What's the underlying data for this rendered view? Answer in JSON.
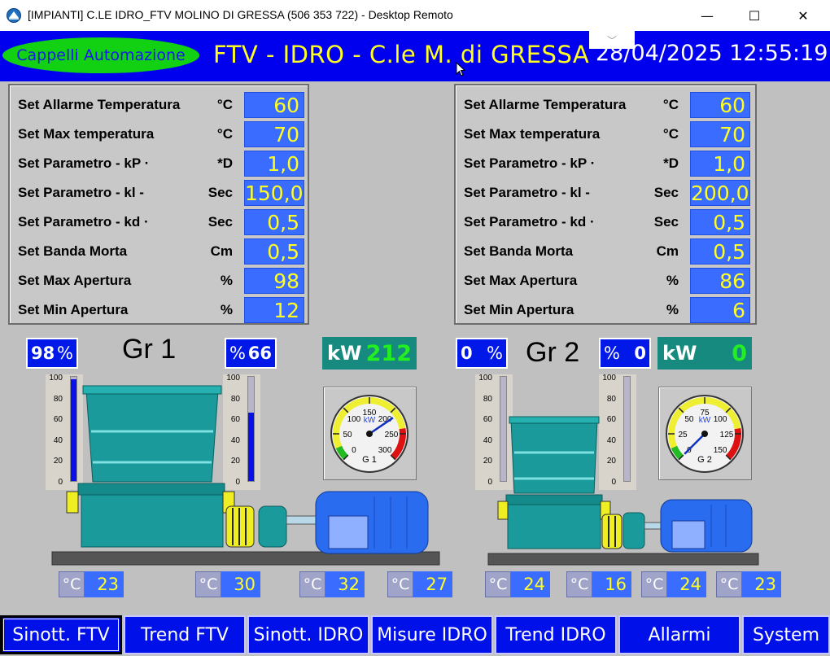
{
  "window": {
    "title": "[IMPIANTI] C.LE IDRO_FTV MOLINO DI GRESSA (506 353 722) - Desktop Remoto",
    "minimize": "—",
    "maximize": "☐",
    "close": "✕"
  },
  "header": {
    "brand": "Cappelli Automazione",
    "title": "FTV - IDRO - C.le M. di GRESSA",
    "datetime": "28/04/2025 12:55:19",
    "rd_chevron": "﹀"
  },
  "panels": [
    {
      "rows": [
        {
          "label": "Set Allarme Temperatura",
          "unit": "°C",
          "value": "60"
        },
        {
          "label": "Set Max temperatura",
          "unit": "°C",
          "value": "70"
        },
        {
          "label": "Set Parametro - kP ·",
          "unit": "*D",
          "value": "1,0"
        },
        {
          "label": "Set Parametro - kl -",
          "unit": "Sec",
          "value": "150,0"
        },
        {
          "label": "Set Parametro - kd ·",
          "unit": "Sec",
          "value": "0,5"
        },
        {
          "label": "Set Banda Morta",
          "unit": "Cm",
          "value": "0,5"
        },
        {
          "label": "Set Max Apertura",
          "unit": "%",
          "value": "98"
        },
        {
          "label": "Set Min Apertura",
          "unit": "%",
          "value": "12"
        }
      ]
    },
    {
      "rows": [
        {
          "label": "Set Allarme Temperatura",
          "unit": "°C",
          "value": "60"
        },
        {
          "label": "Set Max temperatura",
          "unit": "°C",
          "value": "70"
        },
        {
          "label": "Set Parametro - kP ·",
          "unit": "*D",
          "value": "1,0"
        },
        {
          "label": "Set Parametro - kl -",
          "unit": "Sec",
          "value": "200,0"
        },
        {
          "label": "Set Parametro - kd ·",
          "unit": "Sec",
          "value": "0,5"
        },
        {
          "label": "Set Banda Morta",
          "unit": "Cm",
          "value": "0,5"
        },
        {
          "label": "Set Max Apertura",
          "unit": "%",
          "value": "86"
        },
        {
          "label": "Set Min Apertura",
          "unit": "%",
          "value": "6"
        }
      ]
    }
  ],
  "groups": [
    {
      "name": "Gr 1",
      "opening_left": "98",
      "opening_right": "66",
      "pct": "%",
      "kw_label": "kW",
      "kw_value": "212",
      "scale_ticks": [
        "100",
        "80",
        "60",
        "40",
        "20",
        "0"
      ],
      "left_scale_level": 0.98,
      "right_scale_level": 0.66,
      "gauge": {
        "ticks": [
          "0",
          "50",
          "100",
          "150",
          "200",
          "250",
          "300"
        ],
        "unit": "kW",
        "name": "G 1",
        "max": 300,
        "value": 212
      },
      "temps": [
        "23",
        "30",
        "32",
        "27"
      ]
    },
    {
      "name": "Gr 2",
      "opening_left": "0",
      "opening_right": "0",
      "pct": "%",
      "kw_label": "kW",
      "kw_value": "0",
      "scale_ticks": [
        "100",
        "80",
        "60",
        "40",
        "20",
        "0"
      ],
      "left_scale_level": 0.0,
      "right_scale_level": 0.0,
      "gauge": {
        "ticks": [
          "0",
          "25",
          "50",
          "75",
          "100",
          "125",
          "150"
        ],
        "unit": "kW",
        "name": "G 2",
        "max": 150,
        "value": 0
      },
      "temps": [
        "24",
        "16",
        "24",
        "23"
      ]
    }
  ],
  "temp_unit": "°C",
  "nav": [
    "Sinott. FTV",
    "Trend FTV",
    "Sinott. IDRO",
    "Misure IDRO",
    "Trend IDRO",
    "Allarmi",
    "System"
  ],
  "colors": {
    "header_bg": "#0000ee",
    "value_bg": "#3a6cff",
    "value_text": "#ffff22",
    "kw_bg": "#168a7e",
    "kw_value": "#22ee22"
  }
}
